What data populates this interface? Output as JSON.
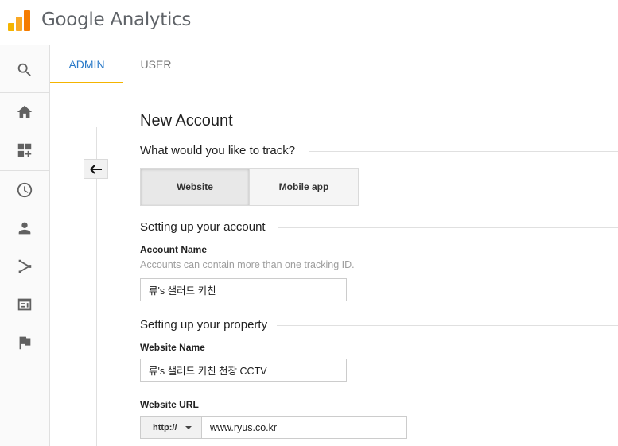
{
  "header": {
    "brand": "Google Analytics",
    "brand_colors": [
      "#f4b400",
      "#f57c00",
      "#e37400"
    ]
  },
  "leftnav": {
    "items": [
      {
        "icon": "search-icon"
      },
      {
        "icon": "home-icon"
      },
      {
        "icon": "customization-icon"
      },
      {
        "icon": "realtime-clock-icon"
      },
      {
        "icon": "audience-person-icon"
      },
      {
        "icon": "acquisition-icon"
      },
      {
        "icon": "behavior-icon"
      },
      {
        "icon": "conversions-flag-icon"
      }
    ]
  },
  "tabs": {
    "admin": "ADMIN",
    "user": "USER",
    "active": "ADMIN"
  },
  "form": {
    "title": "New Account",
    "track_question": "What would you like to track?",
    "track_options": {
      "website": "Website",
      "mobile_app": "Mobile app",
      "selected": "Website"
    },
    "account_section": "Setting up your account",
    "account_name_label": "Account Name",
    "account_name_hint": "Accounts can contain more than one tracking ID.",
    "account_name_value": "류's 샐러드 키친",
    "property_section": "Setting up your property",
    "website_name_label": "Website Name",
    "website_name_value": "류's 샐러드 키친 천장 CCTV",
    "website_url_label": "Website URL",
    "protocol": "http://",
    "website_url_value": "www.ryus.co.kr"
  },
  "colors": {
    "accent_tab": "#2979c8",
    "tab_underline": "#f4b400"
  }
}
